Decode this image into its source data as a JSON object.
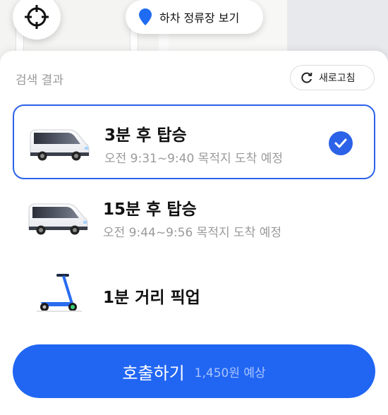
{
  "map": {
    "locate_icon": "crosshair-icon",
    "dropoff_button": {
      "icon": "map-pin-icon",
      "label": "하차 정류장 보기",
      "accent": "#1f6cf2"
    }
  },
  "sheet": {
    "title": "검색 결과",
    "refresh": {
      "icon": "refresh-icon",
      "label": "새로고침"
    }
  },
  "options": [
    {
      "vehicle_icon": "van-icon",
      "title": "3분 후 탑승",
      "subtitle": "오전 9:31~9:40 목적지 도착 예정",
      "selected": true
    },
    {
      "vehicle_icon": "van-icon",
      "title": "15분 후 탑승",
      "subtitle": "오전 9:44~9:56 목적지 도착 예정",
      "selected": false
    },
    {
      "vehicle_icon": "scooter-icon",
      "title": "1분 거리 픽업",
      "subtitle": "",
      "selected": false
    }
  ],
  "call_button": {
    "label": "호출하기",
    "price": "1,450원 예상"
  },
  "colors": {
    "primary": "#2166f3",
    "selected_border": "#2c62e8",
    "muted_text": "#9a9a9a"
  }
}
